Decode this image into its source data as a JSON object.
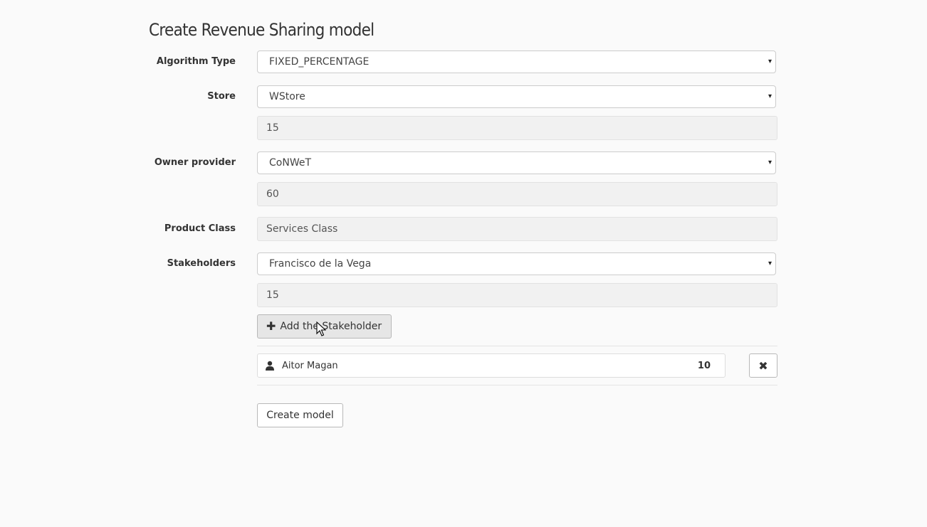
{
  "page": {
    "title": "Create Revenue Sharing model"
  },
  "form": {
    "algorithm_type": {
      "label": "Algorithm Type",
      "value": "FIXED_PERCENTAGE"
    },
    "store": {
      "label": "Store",
      "value": "WStore",
      "percentage": "15"
    },
    "owner_provider": {
      "label": "Owner provider",
      "value": "CoNWeT",
      "percentage": "60"
    },
    "product_class": {
      "label": "Product Class",
      "value": "Services Class"
    },
    "stakeholders": {
      "label": "Stakeholders",
      "value": "Francisco de la Vega",
      "percentage": "15",
      "add_button_label": "Add the Stakeholder",
      "list": [
        {
          "name": "Aitor Magan",
          "percentage": "10",
          "remove_icon": "✖"
        }
      ]
    }
  },
  "actions": {
    "create_label": "Create model"
  },
  "icons": {
    "caret": "▾",
    "plus": "✚",
    "user": "user-icon"
  },
  "colors": {
    "background": "#fafafa",
    "readonly_bg": "#f1f1f1",
    "button_bg": "#e6e6e6"
  }
}
